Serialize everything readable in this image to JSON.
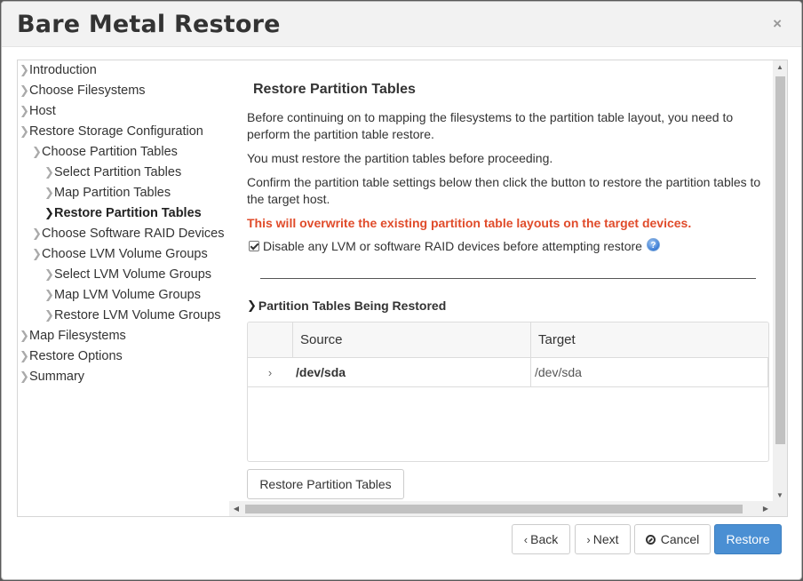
{
  "dialog": {
    "title": "Bare Metal Restore",
    "close_label": "×"
  },
  "sidebar": {
    "items": [
      {
        "label": "Introduction",
        "level": 0,
        "active": false
      },
      {
        "label": "Choose Filesystems",
        "level": 0,
        "active": false
      },
      {
        "label": "Host",
        "level": 0,
        "active": false
      },
      {
        "label": "Restore Storage Configuration",
        "level": 0,
        "active": false
      },
      {
        "label": "Choose Partition Tables",
        "level": 1,
        "active": false
      },
      {
        "label": "Select Partition Tables",
        "level": 2,
        "active": false
      },
      {
        "label": "Map Partition Tables",
        "level": 2,
        "active": false
      },
      {
        "label": "Restore Partition Tables",
        "level": 2,
        "active": true
      },
      {
        "label": "Choose Software RAID Devices",
        "level": 1,
        "active": false
      },
      {
        "label": "Choose LVM Volume Groups",
        "level": 1,
        "active": false
      },
      {
        "label": "Select LVM Volume Groups",
        "level": 2,
        "active": false
      },
      {
        "label": "Map LVM Volume Groups",
        "level": 2,
        "active": false
      },
      {
        "label": "Restore LVM Volume Groups",
        "level": 2,
        "active": false
      },
      {
        "label": "Map Filesystems",
        "level": 0,
        "active": false
      },
      {
        "label": "Restore Options",
        "level": 0,
        "active": false
      },
      {
        "label": "Summary",
        "level": 0,
        "active": false
      }
    ]
  },
  "main": {
    "heading": "Restore Partition Tables",
    "para1": "Before continuing on to mapping the filesystems to the partition table layout, you need to perform the partition table restore.",
    "para2": "You must restore the partition tables before proceeding.",
    "para3": "Confirm the partition table settings below then click the button to restore the partition tables to the target host.",
    "warning": "This will overwrite the existing partition table layouts on the target devices.",
    "checkbox_label": "Disable any LVM or software RAID devices before attempting restore",
    "checkbox_checked": true,
    "help_icon": "?",
    "subsection_title": "Partition Tables Being Restored",
    "table": {
      "columns": [
        "Source",
        "Target"
      ],
      "rows": [
        {
          "source": "/dev/sda",
          "target": "/dev/sda"
        }
      ]
    },
    "restore_button_label": "Restore Partition Tables"
  },
  "footer": {
    "back_label": "Back",
    "next_label": "Next",
    "cancel_label": "Cancel",
    "restore_label": "Restore"
  },
  "colors": {
    "warning": "#e04b2a",
    "primary": "#4a8fd3"
  }
}
